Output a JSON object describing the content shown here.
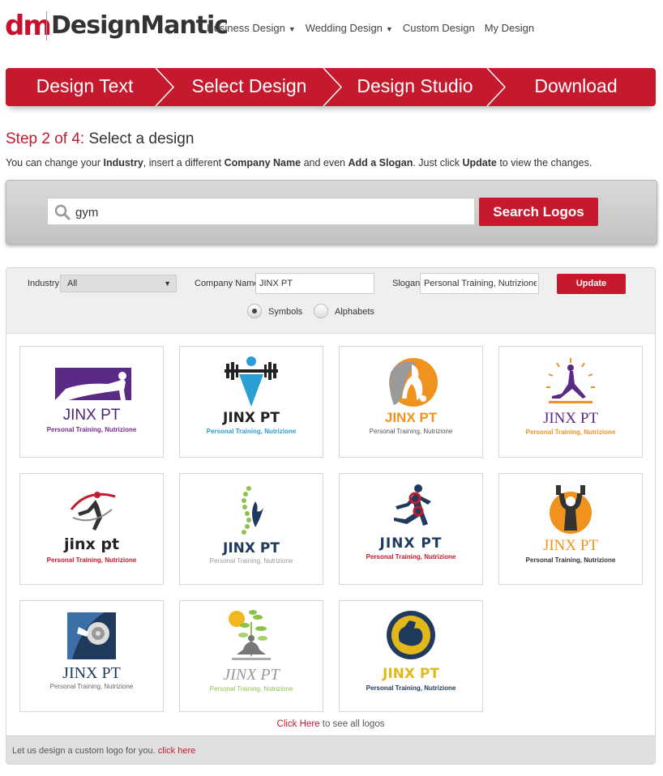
{
  "brand": {
    "mark": "dm",
    "name": "DesignMantic"
  },
  "nav": [
    {
      "label": "Business Design",
      "dropdown": true
    },
    {
      "label": "Wedding Design",
      "dropdown": true
    },
    {
      "label": "Custom Design",
      "dropdown": false
    },
    {
      "label": "My Design",
      "dropdown": false
    }
  ],
  "steps": [
    "Design Text",
    "Select Design",
    "Design Studio",
    "Download"
  ],
  "step_title": {
    "prefix": "Step 2 of 4:",
    "text": "Select a design"
  },
  "intro": {
    "t1": "You can change your ",
    "b1": "Industry",
    "t2": ", insert a different ",
    "b2": "Company Name",
    "t3": " and even ",
    "b3": "Add a Slogan",
    "t4": ". Just click ",
    "b4": "Update",
    "t5": " to view the changes."
  },
  "search": {
    "value": "gym",
    "button": "Search Logos"
  },
  "filters": {
    "industry_label": "Industry",
    "industry_value": "All",
    "company_label": "Company Name",
    "company_value": "JINX PT",
    "slogan_label": "Slogan",
    "slogan_value": "Personal Training, Nutrizione",
    "update": "Update",
    "radio_symbols": "Symbols",
    "radio_alphabets": "Alphabets",
    "selected": "Symbols"
  },
  "logos": [
    {
      "name": "JINX PT",
      "slogan": "Personal Training, Nutrizione",
      "name_color": "#4b2676",
      "slogan_color": "#7a2b8c"
    },
    {
      "name": "JINX PT",
      "slogan": "Personal Training, Nutrizione",
      "name_color": "#222222",
      "slogan_color": "#2a9fd6"
    },
    {
      "name": "JINX PT",
      "slogan": "Personal Training, Nutrizione",
      "name_color": "#f0931e",
      "slogan_color": "#555555"
    },
    {
      "name": "JINX PT",
      "slogan": "Personal Training, Nutrizione",
      "name_color": "#5b2a86",
      "slogan_color": "#f0931e"
    },
    {
      "name": "jinx pt",
      "slogan": "Personal Training, Nutrizione",
      "name_color": "#222222",
      "slogan_color": "#c5192d"
    },
    {
      "name": "JINX PT",
      "slogan": "Personal Training, Nutrizione",
      "name_color": "#1f3a5c",
      "slogan_color": "#999999"
    },
    {
      "name": "JINX PT",
      "slogan": "Personal Training, Nutrizione",
      "name_color": "#1f3a5c",
      "slogan_color": "#c5192d"
    },
    {
      "name": "JINX PT",
      "slogan": "Personal Training, Nutrizione",
      "name_color": "#f0931e",
      "slogan_color": "#333333"
    },
    {
      "name": "JINX PT",
      "slogan": "Personal Training, Nutrizione",
      "name_color": "#1f3a5c",
      "slogan_color": "#666666"
    },
    {
      "name": "JINX PT",
      "slogan": "Personal Training, Nutrizione",
      "name_color": "#999999",
      "slogan_color": "#8bc34a"
    },
    {
      "name": "JINX PT",
      "slogan": "Personal Training, Nutrizione",
      "name_color": "#e2b81b",
      "slogan_color": "#1f3a5c"
    }
  ],
  "see_all": {
    "link": "Click Here",
    "text": " to see all logos"
  },
  "custom": {
    "text": "Let us design a custom logo for you. ",
    "link": "click here"
  },
  "colors": {
    "accent": "#c5192d",
    "steps_bg": "#c5192d"
  }
}
